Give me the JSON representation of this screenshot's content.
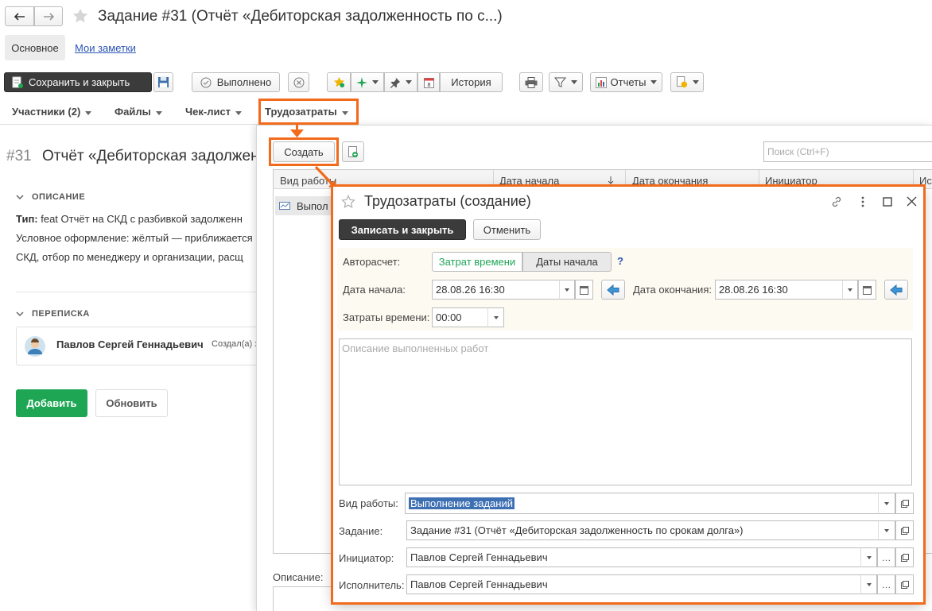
{
  "window": {
    "title": "Задание #31 (Отчёт «Дебиторская задолженность по с...)"
  },
  "top_tabs": {
    "main": "Основное",
    "notes": "Мои заметки"
  },
  "toolbar": {
    "save_close": "Сохранить и закрыть",
    "done": "Выполнено",
    "history": "История",
    "reports": "Отчеты"
  },
  "section_tabs": {
    "participants": "Участники (2)",
    "files": "Файлы",
    "checklist": "Чек-лист",
    "labor": "Трудозатраты"
  },
  "task": {
    "number": "#31",
    "title": "Отчёт «Дебиторская задолжен",
    "description_header": "ОПИСАНИЕ",
    "type_label": "Тип:",
    "type_text": " feat Отчёт на СКД с разбивкой задолженн",
    "line2": "Условное оформление: жёлтый — приближается",
    "line3": "СКД, отбор по менеджеру и организации, расщ",
    "correspondence_header": "ПЕРЕПИСКА",
    "author": "Павлов Сергей Геннадьевич",
    "author_note": "Создал(а) з",
    "add_button": "Добавить",
    "refresh_button": "Обновить"
  },
  "labor_panel": {
    "create_button": "Создать",
    "search_placeholder": "Поиск (Ctrl+F)",
    "columns": [
      "Вид работы",
      "Дата начала",
      "Дата окончания",
      "Инициатор",
      "Ис"
    ],
    "row_first_cell": "Выпол",
    "description_label": "Описание:"
  },
  "dialog": {
    "title": "Трудозатраты (создание)",
    "save_close": "Записать и закрыть",
    "cancel": "Отменить",
    "autocalc_label": "Авторасчет:",
    "autocalc_opt1": "Затрат времени",
    "autocalc_opt2": "Даты начала",
    "help": "?",
    "start_label": "Дата начала:",
    "start_value": "28.08.26 16:30",
    "end_label": "Дата окончания:",
    "end_value": "28.08.26 16:30",
    "time_label": "Затраты времени:",
    "time_value": "00:00",
    "description_placeholder": "Описание выполненных работ",
    "work_type_label": "Вид работы:",
    "work_type_value": "Выполнение заданий",
    "task_label": "Задание:",
    "task_value": "Задание #31 (Отчёт «Дебиторская задолженность по срокам долга»)",
    "initiator_label": "Инициатор:",
    "initiator_value": "Павлов Сергей Геннадьевич",
    "executor_label": "Исполнитель:",
    "executor_value": "Павлов Сергей Геннадьевич"
  },
  "colors": {
    "accent_orange": "#f26a1b",
    "green": "#1ea655",
    "dark_button": "#3b3b3b",
    "link": "#2a55b3"
  }
}
